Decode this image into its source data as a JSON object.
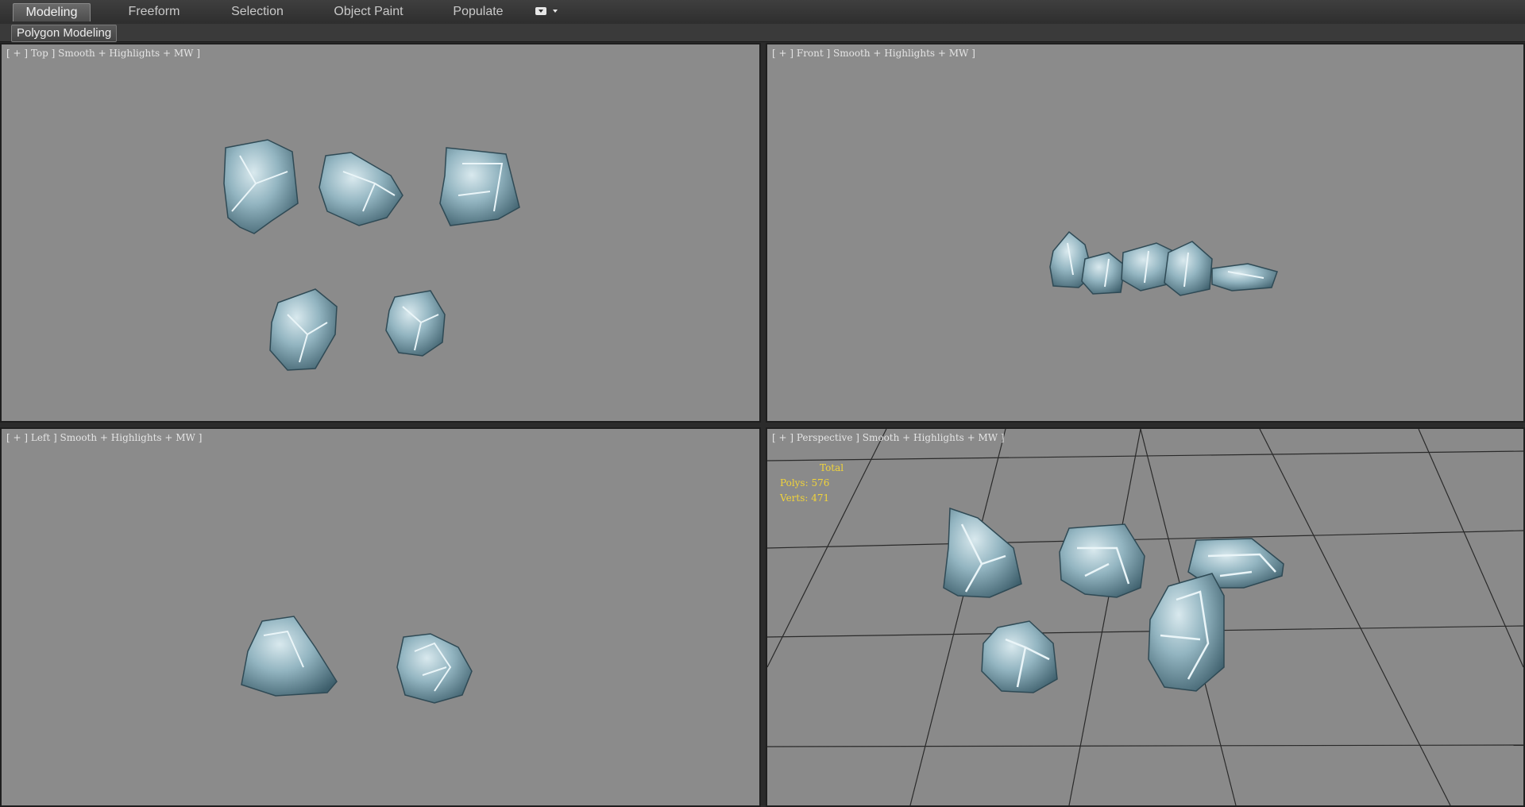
{
  "ribbon": {
    "tabs": [
      {
        "label": "Modeling",
        "active": true
      },
      {
        "label": "Freeform",
        "active": false
      },
      {
        "label": "Selection",
        "active": false
      },
      {
        "label": "Object Paint",
        "active": false
      },
      {
        "label": "Populate",
        "active": false
      }
    ],
    "panel_label": "Polygon Modeling"
  },
  "viewports": {
    "top": {
      "label": "[ + ] Top ] Smooth + Highlights + MW ]"
    },
    "front": {
      "label": "[ + ] Front ] Smooth + Highlights + MW ]"
    },
    "left": {
      "label": "[ + ] Left ] Smooth + Highlights + MW ]"
    },
    "perspective": {
      "label": "[ + ] Perspective ] Smooth + Highlights + MW ]",
      "stats": {
        "total": "Total",
        "polys": "Polys: 576",
        "verts": "Verts: 471"
      }
    }
  },
  "colors": {
    "viewport_bg": "#8b8b8b",
    "rock_base": "#8fb0bc",
    "rock_dark": "#3e5f6c",
    "rock_highlight": "#dfeef2",
    "stats_text": "#f0d33a"
  }
}
